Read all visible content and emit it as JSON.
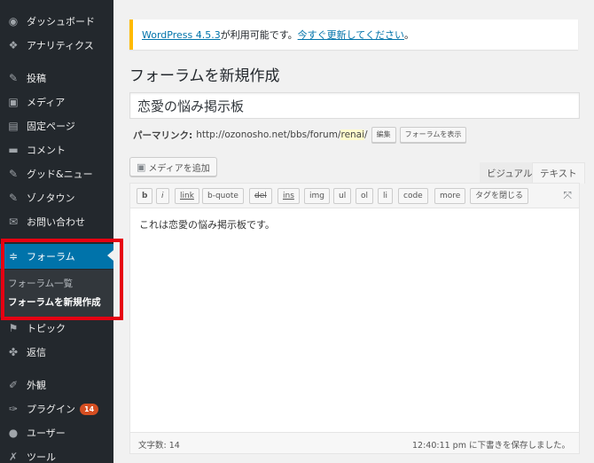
{
  "sidebar": {
    "items": [
      {
        "label": "ダッシュボード",
        "icon": "dashboard-icon",
        "glyph": "◉"
      },
      {
        "label": "アナリティクス",
        "icon": "analytics-icon",
        "glyph": "❖"
      },
      {
        "label": "投稿",
        "icon": "pin-icon",
        "glyph": "✎"
      },
      {
        "label": "メディア",
        "icon": "media-icon",
        "glyph": "▣"
      },
      {
        "label": "固定ページ",
        "icon": "page-icon",
        "glyph": "▤"
      },
      {
        "label": "コメント",
        "icon": "comment-icon",
        "glyph": "▬"
      },
      {
        "label": "グッド&ニュー",
        "icon": "pin-icon",
        "glyph": "✎"
      },
      {
        "label": "ゾノタウン",
        "icon": "pin-icon",
        "glyph": "✎"
      },
      {
        "label": "お問い合わせ",
        "icon": "mail-icon",
        "glyph": "✉"
      },
      {
        "label": "フォーラム",
        "icon": "forum-icon",
        "glyph": "≑"
      },
      {
        "label": "トピック",
        "icon": "topic-icon",
        "glyph": "⚑"
      },
      {
        "label": "返信",
        "icon": "reply-icon",
        "glyph": "✤"
      },
      {
        "label": "外観",
        "icon": "appearance-icon",
        "glyph": "✐"
      },
      {
        "label": "プラグイン",
        "icon": "plugin-icon",
        "glyph": "✑",
        "badge": "14"
      },
      {
        "label": "ユーザー",
        "icon": "user-icon",
        "glyph": "●"
      },
      {
        "label": "ツール",
        "icon": "wrench-icon",
        "glyph": "✗"
      }
    ],
    "submenu": [
      "フォーラム一覧",
      "フォーラムを新規作成"
    ]
  },
  "notice": {
    "version_link": "WordPress 4.5.3",
    "text": " が利用可能です。",
    "update_link": "今すぐ更新してください",
    "end": "。"
  },
  "page_title": "フォーラムを新規作成",
  "title_value": "恋愛の悩み掲示板",
  "permalink": {
    "label": "パーマリンク:",
    "base": "http://ozonosho.net/bbs/forum/",
    "slug": "renai",
    "end": "/",
    "edit_button": "編集",
    "view_button": "フォーラムを表示"
  },
  "editor": {
    "media_button": "メディアを追加",
    "tab_visual": "ビジュアル",
    "tab_text": "テキスト",
    "quicktags": [
      "b",
      "i",
      "link",
      "b-quote",
      "del",
      "ins",
      "img",
      "ul",
      "ol",
      "li",
      "code",
      "more",
      "タグを閉じる"
    ],
    "content": "これは恋愛の悩み掲示板です。",
    "word_count": "文字数: 14",
    "autosave": "12:40:11 pm に下書きを保存しました。"
  },
  "colors": {
    "sidebar_bg": "#23282d",
    "active_bg": "#0073aa",
    "highlight_border": "#e60012",
    "notice_border": "#ffba00",
    "badge": "#d54e21"
  }
}
